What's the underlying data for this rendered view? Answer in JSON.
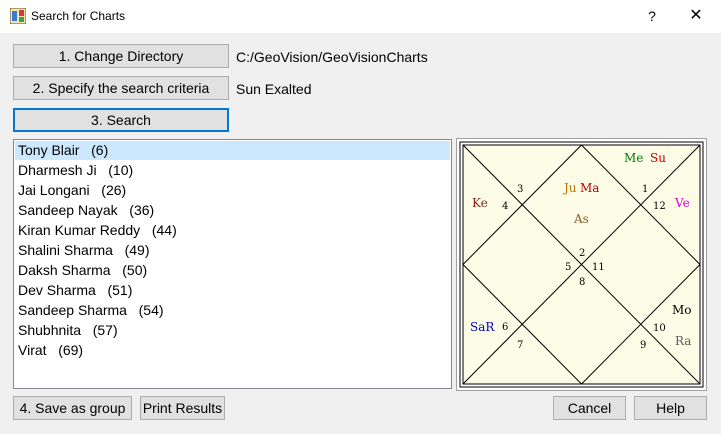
{
  "window": {
    "title": "Search for Charts",
    "help_glyph": "?",
    "close_glyph": "✕"
  },
  "controls": {
    "change_directory_label": "1. Change Directory",
    "directory_path": "C:/GeoVision/GeoVisionCharts",
    "specify_criteria_label": "2. Specify the search criteria",
    "criteria_value": "Sun Exalted",
    "search_label": "3. Search"
  },
  "results": [
    "Tony Blair   (6)",
    "Dharmesh Ji   (10)",
    "Jai Longani   (26)",
    "Sandeep Nayak   (36)",
    "Kiran Kumar Reddy   (44)",
    "Shalini Sharma   (49)",
    "Daksh Sharma   (50)",
    "Dev Sharma   (51)",
    "Sandeep Sharma   (54)",
    "Shubhnita   (57)",
    "Virat   (69)"
  ],
  "selected_index": 0,
  "chart": {
    "background": "#fdfce6",
    "house_numbers": [
      "1",
      "2",
      "3",
      "4",
      "5",
      "6",
      "7",
      "8",
      "9",
      "10",
      "11",
      "12"
    ],
    "planets": [
      {
        "text": "Me",
        "color": "#008000"
      },
      {
        "text": "Su",
        "color": "#c00000"
      },
      {
        "text": "Ju",
        "color": "#c07000"
      },
      {
        "text": "Ma",
        "color": "#c00000"
      },
      {
        "text": "As",
        "color": "#8b5a2b"
      },
      {
        "text": "Ke",
        "color": "#8b2222"
      },
      {
        "text": "Ve",
        "color": "#e000e0"
      },
      {
        "text": "SaR",
        "color": "#0000c0"
      },
      {
        "text": "Mo",
        "color": "#000000"
      },
      {
        "text": "Ra",
        "color": "#5c5c5c"
      }
    ]
  },
  "footer": {
    "save_group_label": "4. Save as group",
    "print_results_label": "Print Results",
    "cancel_label": "Cancel",
    "help_label": "Help"
  }
}
